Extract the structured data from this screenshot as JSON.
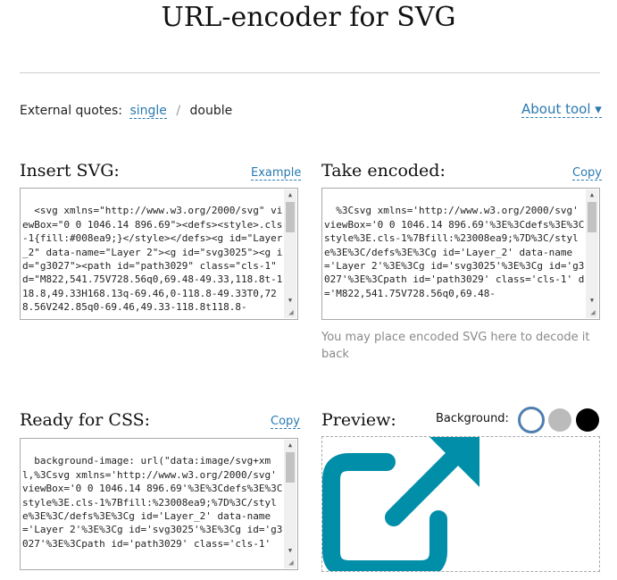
{
  "page": {
    "title": "URL-encoder for SVG"
  },
  "quotes": {
    "label": "External quotes:",
    "single": "single",
    "separator": "/",
    "double": "double"
  },
  "about": {
    "label": "About tool ▾"
  },
  "insert": {
    "title": "Insert SVG:",
    "link": "Example",
    "text": "<svg xmlns=\"http://www.w3.org/2000/svg\" viewBox=\"0 0 1046.14 896.69\"><defs><style>.cls-1{fill:#008ea9;}</style></defs><g id=\"Layer_2\" data-name=\"Layer 2\"><g id=\"svg3025\"><g id=\"g3027\"><path id=\"path3029\" class=\"cls-1\" d=\"M822,541.75V728.56q0,69.48-49.33,118.8t-118.8,49.33H168.13q-69.46,0-118.8-49.33T0,728.56V242.85q0-69.46,49.33-118.8t118.8-"
  },
  "encoded": {
    "title": "Take encoded:",
    "link": "Copy",
    "text": "%3Csvg xmlns='http://www.w3.org/2000/svg' viewBox='0 0 1046.14 896.69'%3E%3Cdefs%3E%3Cstyle%3E.cls-1%7Bfill:%23008ea9;%7D%3C/style%3E%3C/defs%3E%3Cg id='Layer_2' data-name='Layer 2'%3E%3Cg id='svg3025'%3E%3Cg id='g3027'%3E%3Cpath id='path3029' class='cls-1' d='M822,541.75V728.56q0,69.48-",
    "hint": "You may place encoded SVG here to decode it back"
  },
  "css": {
    "title": "Ready for CSS:",
    "link": "Copy",
    "text": "background-image: url(\"data:image/svg+xml,%3Csvg xmlns='http://www.w3.org/2000/svg' viewBox='0 0 1046.14 896.69'%3E%3Cdefs%3E%3Cstyle%3E.cls-1%7Bfill:%23008ea9;%7D%3C/style%3E%3C/defs%3E%3Cg id='Layer_2' data-name='Layer 2'%3E%3Cg id='svg3025'%3E%3Cg id='g3027'%3E%3Cpath id='path3029' class='cls-1'"
  },
  "preview": {
    "title": "Preview:",
    "background_label": "Background:",
    "swatches": [
      "white",
      "silver",
      "black"
    ],
    "icon": "external-link-icon",
    "icon_color": "#008ea9"
  },
  "colors": {
    "link": "#2a7ab0",
    "swatch_selected_border": "#4f7fae",
    "swatch_silver": "#bbbbbb",
    "swatch_black": "#000000"
  }
}
